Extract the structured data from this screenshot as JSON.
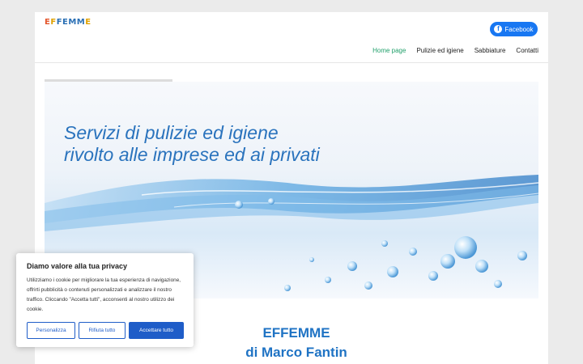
{
  "header": {
    "logo_text": "EFFEMME",
    "facebook_label": "Facebook",
    "facebook_icon": "facebook-icon",
    "nav": [
      {
        "label": "Home page",
        "active": true
      },
      {
        "label": "Pulizie ed igiene",
        "active": false
      },
      {
        "label": "Sabbiature",
        "active": false
      },
      {
        "label": "Contatti",
        "active": false
      }
    ]
  },
  "hero": {
    "line1": "Servizi di pulizie ed igiene",
    "line2": "rivolto alle imprese ed ai privati"
  },
  "content": {
    "title1": "EFFEMME",
    "title2": "di Marco Fantin"
  },
  "cookie_banner": {
    "title": "Diamo valore alla tua privacy",
    "text": "Utilizziamo i cookie per migliorare la tua esperienza di navigazione, offrirti pubblicità o contenuti personalizzati e analizzare il nostro traffico. Cliccando \"Accetta tutti\", acconsenti al nostro utilizzo dei cookie.",
    "buttons": {
      "customize": "Personalizza",
      "reject": "Rifiuta tutto",
      "accept": "Accettare tutto"
    }
  },
  "colors": {
    "accent_green": "#22a06b",
    "brand_blue": "#1f73c4",
    "facebook_blue": "#1877f2",
    "button_blue": "#1f5dc8"
  }
}
